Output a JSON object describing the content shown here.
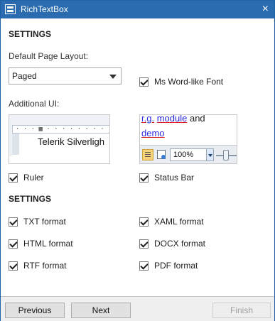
{
  "window": {
    "title": "RichTextBox",
    "close_glyph": "×"
  },
  "page_layout": {
    "heading": "SETTINGS",
    "default_page_layout_label": "Default Page Layout:",
    "selected_layout": "Paged",
    "ms_word_font_label": "Ms Word-like Font",
    "additional_ui_label": "Additional UI:"
  },
  "ruler_preview": {
    "ruler_marks": "· · · ▦ · · · · · · · · · 1",
    "sample_text": "Telerik Silverligh"
  },
  "status_preview": {
    "line1_link1": "r.g.",
    "line1_link2": "module",
    "line1_text": "and",
    "line2_link": "demo",
    "zoom": "100%"
  },
  "ui_options": {
    "ruler_label": "Ruler",
    "status_bar_label": "Status Bar"
  },
  "formats": {
    "heading": "SETTINGS",
    "items": [
      {
        "label": "TXT format"
      },
      {
        "label": "XAML format"
      },
      {
        "label": "HTML format"
      },
      {
        "label": "DOCX format"
      },
      {
        "label": "RTF format"
      },
      {
        "label": "PDF format"
      }
    ]
  },
  "footer": {
    "previous_label": "Previous",
    "next_label": "Next",
    "finish_label": "Finish"
  }
}
